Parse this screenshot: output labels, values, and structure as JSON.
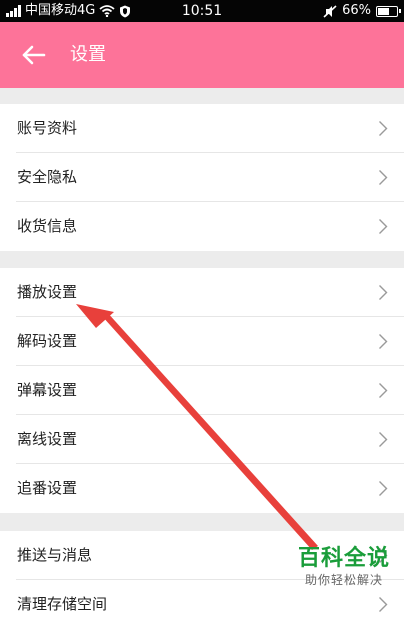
{
  "status_bar": {
    "carrier": "中国移动4G",
    "time": "10:51",
    "battery_percent": "66%",
    "battery_level": 0.66
  },
  "header": {
    "title": "设置",
    "back_icon": "arrow-left-icon"
  },
  "sections": [
    {
      "items": [
        "账号资料",
        "安全隐私",
        "收货信息"
      ]
    },
    {
      "items": [
        "播放设置",
        "解码设置",
        "弹幕设置",
        "离线设置",
        "追番设置"
      ]
    },
    {
      "items": [
        "推送与消息",
        "清理存储空间"
      ]
    }
  ],
  "watermark": {
    "main": "百科全说",
    "sub": "助你轻松解决"
  },
  "colors": {
    "accent": "#fd7399",
    "divider": "#e6e6e6",
    "gap": "#ececec",
    "annotation_arrow": "#e8403b",
    "watermark_green": "#1a9d3a"
  }
}
